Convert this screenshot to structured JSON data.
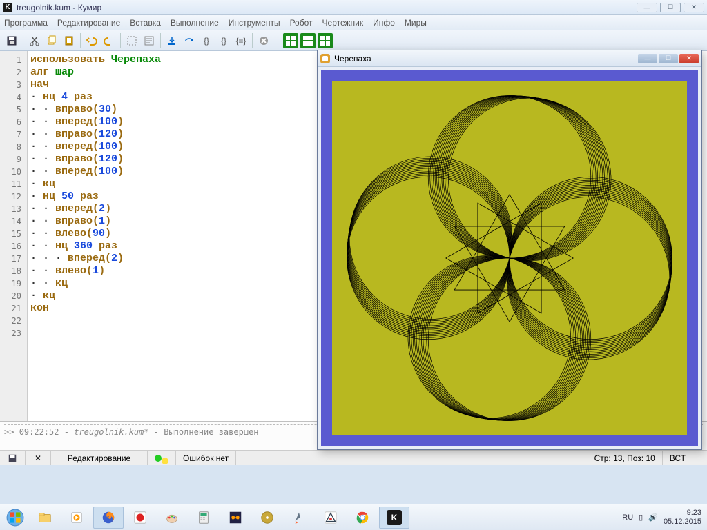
{
  "window": {
    "title": "treugolnik.kum - Кумир",
    "icon_letter": "K"
  },
  "menu": [
    "Программа",
    "Редактирование",
    "Вставка",
    "Выполнение",
    "Инструменты",
    "Робот",
    "Чертежник",
    "Инфо",
    "Миры"
  ],
  "code": {
    "lines": [
      [
        {
          "t": "использовать ",
          "c": "kw"
        },
        {
          "t": "Черепаха",
          "c": "green"
        }
      ],
      [
        {
          "t": "алг ",
          "c": "kw"
        },
        {
          "t": "шар",
          "c": "green"
        }
      ],
      [
        {
          "t": "нач",
          "c": "kw"
        }
      ],
      [
        {
          "t": "· ",
          "c": "dot"
        },
        {
          "t": "нц ",
          "c": "kw"
        },
        {
          "t": "4",
          "c": "num"
        },
        {
          "t": " раз",
          "c": "kw"
        }
      ],
      [
        {
          "t": "· · ",
          "c": "dot"
        },
        {
          "t": "вправо",
          "c": "kw"
        },
        {
          "t": "(",
          "c": "paren"
        },
        {
          "t": "30",
          "c": "num"
        },
        {
          "t": ")",
          "c": "paren"
        }
      ],
      [
        {
          "t": "· · ",
          "c": "dot"
        },
        {
          "t": "вперед",
          "c": "kw"
        },
        {
          "t": "(",
          "c": "paren"
        },
        {
          "t": "100",
          "c": "num"
        },
        {
          "t": ")",
          "c": "paren"
        }
      ],
      [
        {
          "t": "· · ",
          "c": "dot"
        },
        {
          "t": "вправо",
          "c": "kw"
        },
        {
          "t": "(",
          "c": "paren"
        },
        {
          "t": "120",
          "c": "num"
        },
        {
          "t": ")",
          "c": "paren"
        }
      ],
      [
        {
          "t": "· · ",
          "c": "dot"
        },
        {
          "t": "вперед",
          "c": "kw"
        },
        {
          "t": "(",
          "c": "paren"
        },
        {
          "t": "100",
          "c": "num"
        },
        {
          "t": ")",
          "c": "paren"
        }
      ],
      [
        {
          "t": "· · ",
          "c": "dot"
        },
        {
          "t": "вправо",
          "c": "kw"
        },
        {
          "t": "(",
          "c": "paren"
        },
        {
          "t": "120",
          "c": "num"
        },
        {
          "t": ")",
          "c": "paren"
        }
      ],
      [
        {
          "t": "· · ",
          "c": "dot"
        },
        {
          "t": "вперед",
          "c": "kw"
        },
        {
          "t": "(",
          "c": "paren"
        },
        {
          "t": "100",
          "c": "num"
        },
        {
          "t": ")",
          "c": "paren"
        }
      ],
      [
        {
          "t": "· ",
          "c": "dot"
        },
        {
          "t": "кц",
          "c": "kw"
        }
      ],
      [
        {
          "t": "· ",
          "c": "dot"
        },
        {
          "t": "нц ",
          "c": "kw"
        },
        {
          "t": "50",
          "c": "num"
        },
        {
          "t": " раз",
          "c": "kw"
        }
      ],
      [
        {
          "t": "· · ",
          "c": "dot"
        },
        {
          "t": "вперед",
          "c": "kw"
        },
        {
          "t": "(",
          "c": "paren"
        },
        {
          "t": "2",
          "c": "num"
        },
        {
          "t": ")",
          "c": "paren"
        }
      ],
      [
        {
          "t": "· · ",
          "c": "dot"
        },
        {
          "t": "вправо",
          "c": "kw"
        },
        {
          "t": "(",
          "c": "paren"
        },
        {
          "t": "1",
          "c": "num"
        },
        {
          "t": ")",
          "c": "paren"
        }
      ],
      [
        {
          "t": "· · ",
          "c": "dot"
        },
        {
          "t": "влево",
          "c": "kw"
        },
        {
          "t": "(",
          "c": "paren"
        },
        {
          "t": "90",
          "c": "num"
        },
        {
          "t": ")",
          "c": "paren"
        }
      ],
      [
        {
          "t": "· · ",
          "c": "dot"
        },
        {
          "t": "нц ",
          "c": "kw"
        },
        {
          "t": "360",
          "c": "num"
        },
        {
          "t": " раз",
          "c": "kw"
        }
      ],
      [
        {
          "t": "· · · ",
          "c": "dot"
        },
        {
          "t": "вперед",
          "c": "kw"
        },
        {
          "t": "(",
          "c": "paren"
        },
        {
          "t": "2",
          "c": "num"
        },
        {
          "t": ")",
          "c": "paren"
        }
      ],
      [
        {
          "t": "· · ",
          "c": "dot"
        },
        {
          "t": "влево",
          "c": "kw"
        },
        {
          "t": "(",
          "c": "paren"
        },
        {
          "t": "1",
          "c": "num"
        },
        {
          "t": ")",
          "c": "paren"
        }
      ],
      [
        {
          "t": "· · ",
          "c": "dot"
        },
        {
          "t": "кц",
          "c": "kw"
        }
      ],
      [
        {
          "t": "· ",
          "c": "dot"
        },
        {
          "t": "кц",
          "c": "kw"
        }
      ],
      [
        {
          "t": "кон",
          "c": "kw"
        }
      ],
      [],
      []
    ],
    "line_count": 23
  },
  "console": {
    "time": "09:22:52",
    "file": "treugolnik.kum*",
    "msg": "Выполнение завершен"
  },
  "status": {
    "mode": "Редактирование",
    "errors": "Ошибок нет",
    "pos": "Стр: 13, Поз: 10",
    "ins": "ВСТ"
  },
  "turtle_window": {
    "title": "Черепаха"
  },
  "taskbar": {
    "lang": "RU",
    "time": "9:23",
    "date": "05.12.2015"
  }
}
